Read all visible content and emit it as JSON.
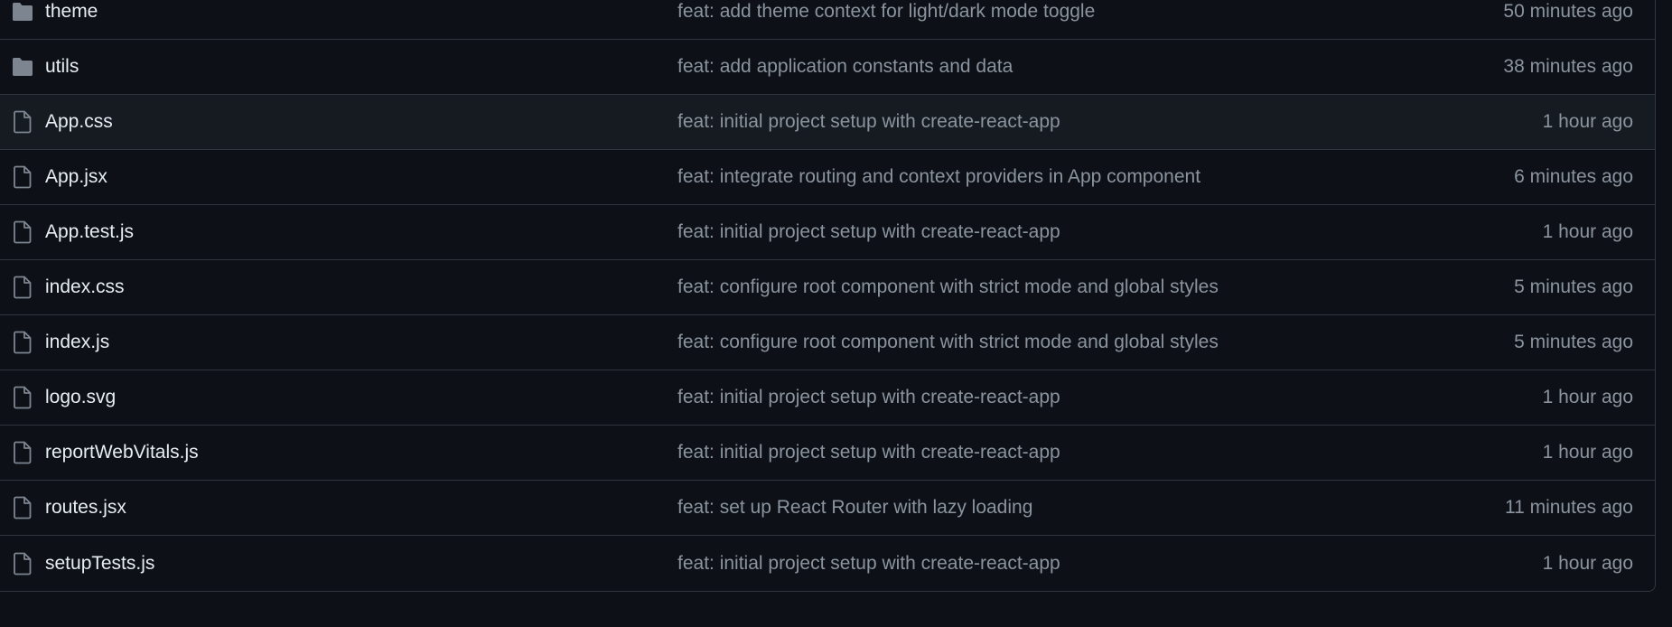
{
  "colors": {
    "background": "#0d1117",
    "row_highlight": "#161b22",
    "border": "#30363d",
    "name_text": "#e6edf3",
    "muted_text": "#8b949e",
    "folder_icon": "#7d8590"
  },
  "rows": [
    {
      "type": "folder",
      "icon": "folder-icon",
      "name": "theme",
      "message": "feat: add theme context for light/dark mode toggle",
      "time": "50 minutes ago"
    },
    {
      "type": "folder",
      "icon": "folder-icon",
      "name": "utils",
      "message": "feat: add application constants and data",
      "time": "38 minutes ago"
    },
    {
      "type": "file",
      "icon": "file-icon",
      "name": "App.css",
      "message": "feat: initial project setup with create-react-app",
      "time": "1 hour ago"
    },
    {
      "type": "file",
      "icon": "file-icon",
      "name": "App.jsx",
      "message": "feat: integrate routing and context providers in App component",
      "time": "6 minutes ago"
    },
    {
      "type": "file",
      "icon": "file-icon",
      "name": "App.test.js",
      "message": "feat: initial project setup with create-react-app",
      "time": "1 hour ago"
    },
    {
      "type": "file",
      "icon": "file-icon",
      "name": "index.css",
      "message": "feat: configure root component with strict mode and global styles",
      "time": "5 minutes ago"
    },
    {
      "type": "file",
      "icon": "file-icon",
      "name": "index.js",
      "message": "feat: configure root component with strict mode and global styles",
      "time": "5 minutes ago"
    },
    {
      "type": "file",
      "icon": "file-icon",
      "name": "logo.svg",
      "message": "feat: initial project setup with create-react-app",
      "time": "1 hour ago"
    },
    {
      "type": "file",
      "icon": "file-icon",
      "name": "reportWebVitals.js",
      "message": "feat: initial project setup with create-react-app",
      "time": "1 hour ago"
    },
    {
      "type": "file",
      "icon": "file-icon",
      "name": "routes.jsx",
      "message": "feat: set up React Router with lazy loading",
      "time": "11 minutes ago"
    },
    {
      "type": "file",
      "icon": "file-icon",
      "name": "setupTests.js",
      "message": "feat: initial project setup with create-react-app",
      "time": "1 hour ago"
    }
  ]
}
